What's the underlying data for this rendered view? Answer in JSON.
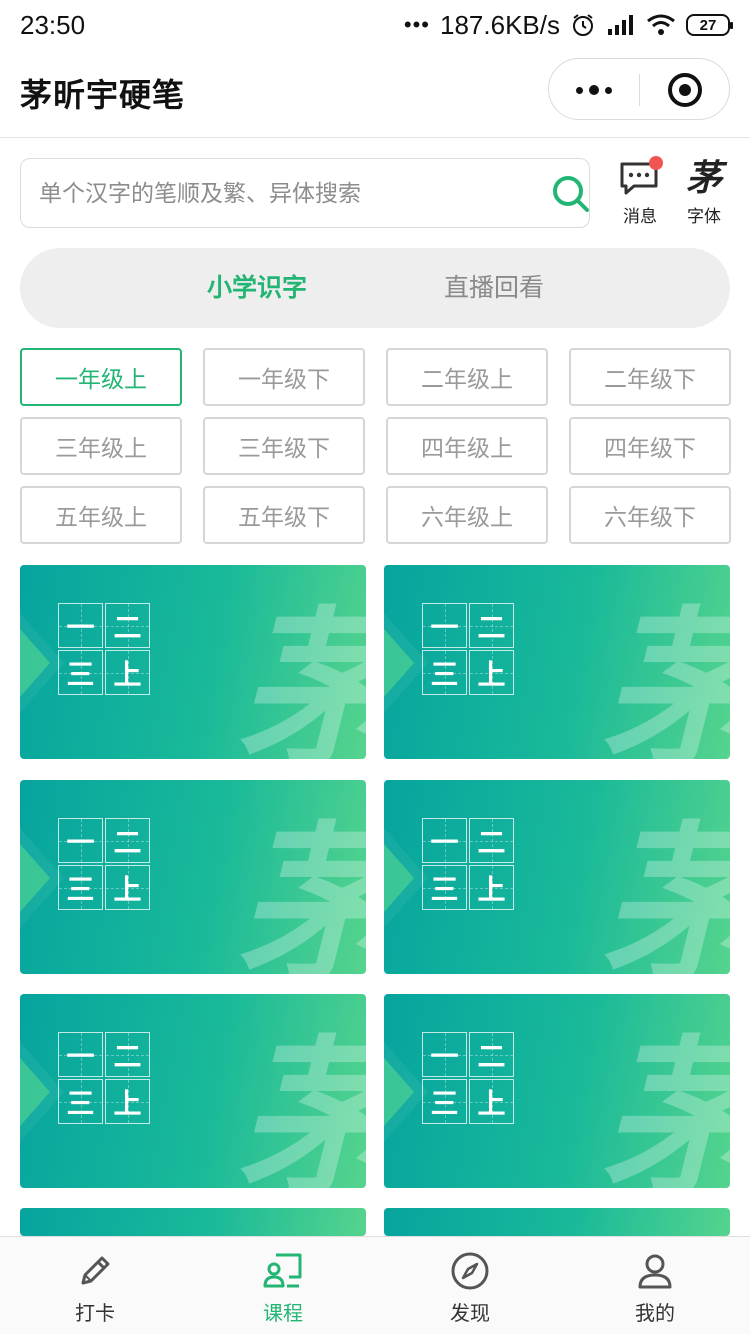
{
  "status_bar": {
    "time": "23:50",
    "network_speed": "187.6KB/s",
    "battery": "27"
  },
  "header": {
    "title": "茅昕宇硬笔",
    "more_icon": "more-dots-icon",
    "close_icon": "record-close-icon"
  },
  "search": {
    "placeholder": "单个汉字的笔顺及繁、异体搜索",
    "icon": "search-icon"
  },
  "actions": {
    "messages_label": "消息",
    "messages_has_unread": true,
    "font_label": "字体",
    "font_glyph": "茅"
  },
  "tabs": [
    {
      "label": "小学识字",
      "active": true
    },
    {
      "label": "直播回看",
      "active": false
    }
  ],
  "grades": [
    {
      "label": "一年级上",
      "active": true
    },
    {
      "label": "一年级下",
      "active": false
    },
    {
      "label": "二年级上",
      "active": false
    },
    {
      "label": "二年级下",
      "active": false
    },
    {
      "label": "三年级上",
      "active": false
    },
    {
      "label": "三年级下",
      "active": false
    },
    {
      "label": "四年级上",
      "active": false
    },
    {
      "label": "四年级下",
      "active": false
    },
    {
      "label": "五年级上",
      "active": false
    },
    {
      "label": "五年级下",
      "active": false
    },
    {
      "label": "六年级上",
      "active": false
    },
    {
      "label": "六年级下",
      "active": false
    }
  ],
  "course_cards": [
    {
      "chars": [
        "一",
        "二",
        "三",
        "上"
      ],
      "watermark": "茅"
    },
    {
      "chars": [
        "一",
        "二",
        "三",
        "上"
      ],
      "watermark": "茅"
    },
    {
      "chars": [
        "一",
        "二",
        "三",
        "上"
      ],
      "watermark": "茅"
    },
    {
      "chars": [
        "一",
        "二",
        "三",
        "上"
      ],
      "watermark": "茅"
    },
    {
      "chars": [
        "一",
        "二",
        "三",
        "上"
      ],
      "watermark": "茅"
    },
    {
      "chars": [
        "一",
        "二",
        "三",
        "上"
      ],
      "watermark": "茅"
    }
  ],
  "bottom_nav": [
    {
      "label": "打卡",
      "icon": "pen-icon",
      "active": false
    },
    {
      "label": "课程",
      "icon": "course-icon",
      "active": true
    },
    {
      "label": "发现",
      "icon": "compass-icon",
      "active": false
    },
    {
      "label": "我的",
      "icon": "user-icon",
      "active": false
    }
  ],
  "colors": {
    "accent": "#22b573",
    "card_gradient_start": "#06a49e",
    "card_gradient_end": "#55d48d",
    "unread_dot": "#f25454"
  }
}
